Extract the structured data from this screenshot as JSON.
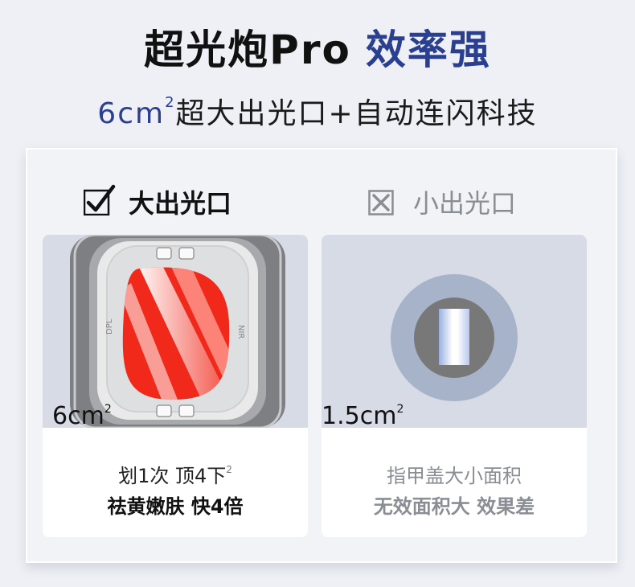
{
  "header": {
    "title_main": "超光炮Pro",
    "title_accent": "效率强",
    "subtitle_num": "6cm",
    "subtitle_sup": "2",
    "subtitle_rest": "超大出光口+自动连闪科技"
  },
  "left": {
    "heading": "大出光口",
    "area": "6cm",
    "area_sup": "2",
    "line1": "划1次 顶4下",
    "line1_sup": "2",
    "line2": "祛黄嫩肤 快4倍",
    "device_label_left": "DPL",
    "device_label_right": "NIR"
  },
  "right": {
    "heading": "小出光口",
    "area": "1.5cm",
    "area_sup": "2",
    "line1": "指甲盖大小面积",
    "line2": "无效面积大 效果差"
  },
  "colors": {
    "accent": "#2a3f8f",
    "red": "#f0291a",
    "card_bg": "#d6dbe6"
  }
}
